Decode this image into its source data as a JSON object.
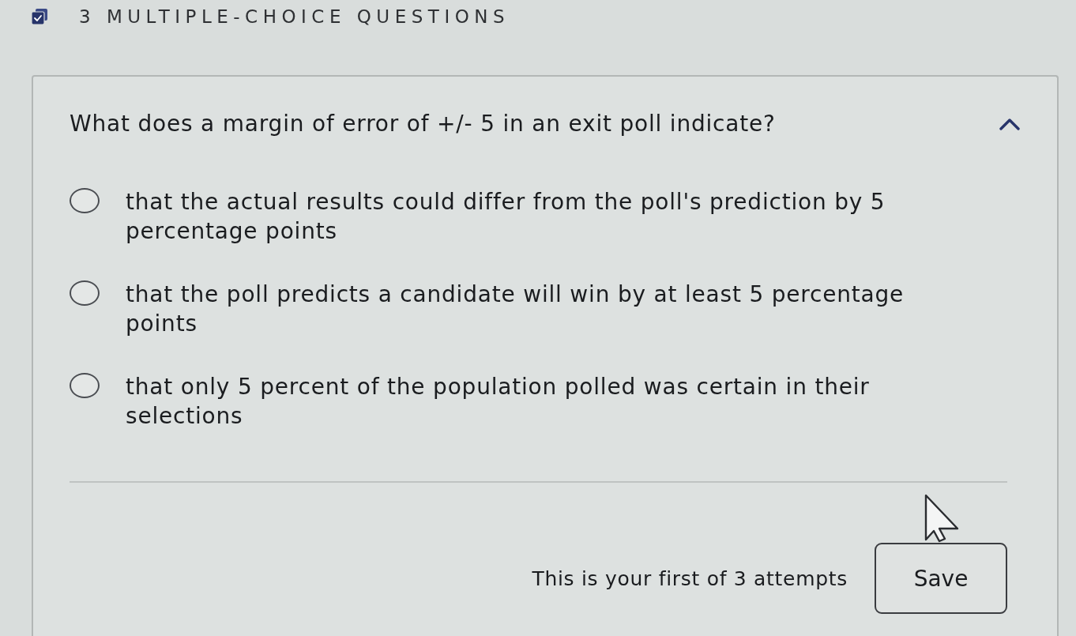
{
  "header": {
    "title": "3 MULTIPLE-CHOICE QUESTIONS"
  },
  "question": {
    "prompt": "What does a margin of error of +/- 5 in an exit poll indicate?",
    "expanded": true,
    "options": [
      {
        "text": "that the actual results could differ from the poll's prediction by 5 percentage points",
        "selected": false
      },
      {
        "text": "that the poll predicts a candidate will win by at least 5 percentage points",
        "selected": false
      },
      {
        "text": "that only 5 percent of the population polled was certain in their selections",
        "selected": false
      }
    ]
  },
  "footer": {
    "attempts": "This is your first of 3 attempts",
    "button": "Save"
  }
}
